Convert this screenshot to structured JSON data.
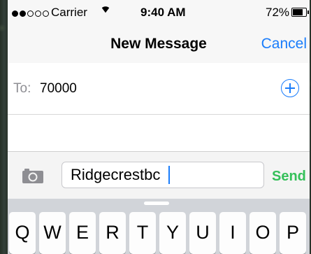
{
  "status_bar": {
    "carrier": "Carrier",
    "time": "9:40 AM",
    "battery_percent": "72%",
    "battery_level": 0.72,
    "signal_bars_filled": 2,
    "signal_bars_total": 5
  },
  "nav": {
    "title": "New Message",
    "cancel_label": "Cancel"
  },
  "recipient": {
    "label": "To:",
    "value": "70000",
    "add_icon": "plus-circle-icon"
  },
  "compose": {
    "camera_icon": "camera-icon",
    "text": "Ridgecrestbc",
    "send_label": "Send"
  },
  "keyboard": {
    "keys": [
      "Q",
      "W",
      "E",
      "R",
      "T",
      "Y",
      "U",
      "I",
      "O",
      "P"
    ]
  },
  "colors": {
    "accent": "#1a7dfb",
    "send": "#35c05a"
  }
}
